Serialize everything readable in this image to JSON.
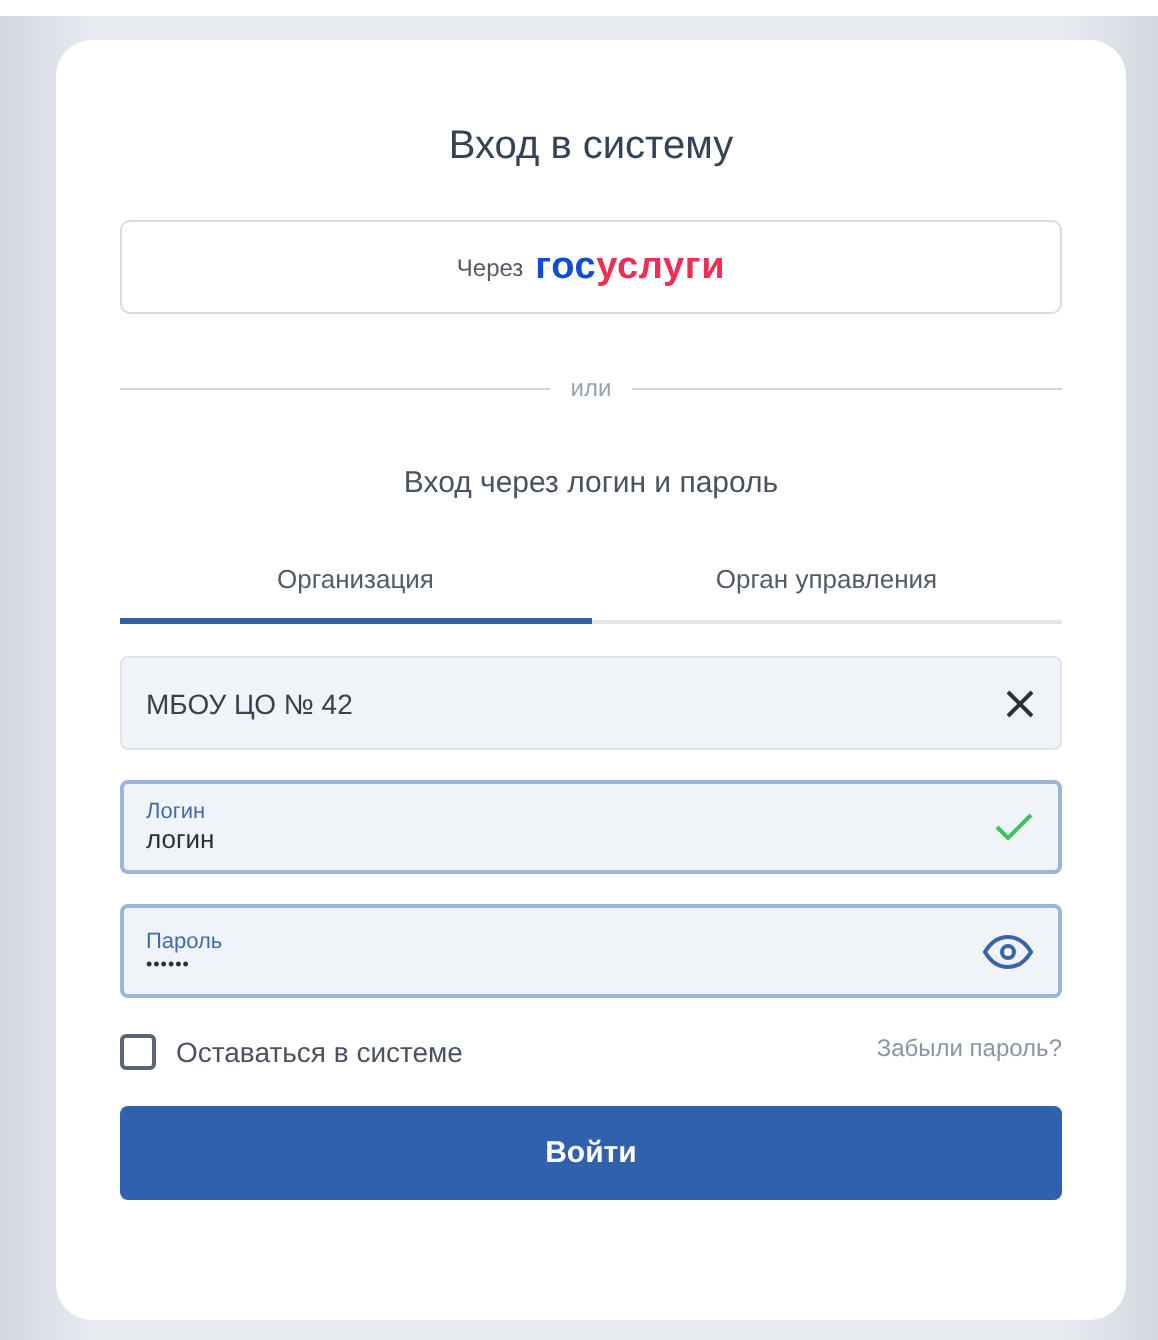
{
  "title": "Вход в систему",
  "gosuslugi": {
    "prefix": "Через",
    "logo_parts": [
      {
        "text": "гос",
        "color": "#0d4cd3"
      },
      {
        "text": "услуги",
        "color": "#ee2f53"
      }
    ]
  },
  "divider_text": "или",
  "subtitle": "Вход через логин и пароль",
  "tabs": [
    {
      "label": "Организация",
      "selected": true
    },
    {
      "label": "Орган управления",
      "selected": false
    }
  ],
  "fields": [
    {
      "kind": "select",
      "value": "МБОУ ЦО № 42",
      "focused": false
    },
    {
      "kind": "text",
      "label": "Логин",
      "value": "логин",
      "valid": true,
      "focused": true
    },
    {
      "kind": "password",
      "label": "Пароль",
      "value": "••••••",
      "focused": true
    }
  ],
  "remember": {
    "label": "Оставаться в системе",
    "checked": false
  },
  "forgot_link": "Забыли пароль?",
  "submit": "Войти"
}
